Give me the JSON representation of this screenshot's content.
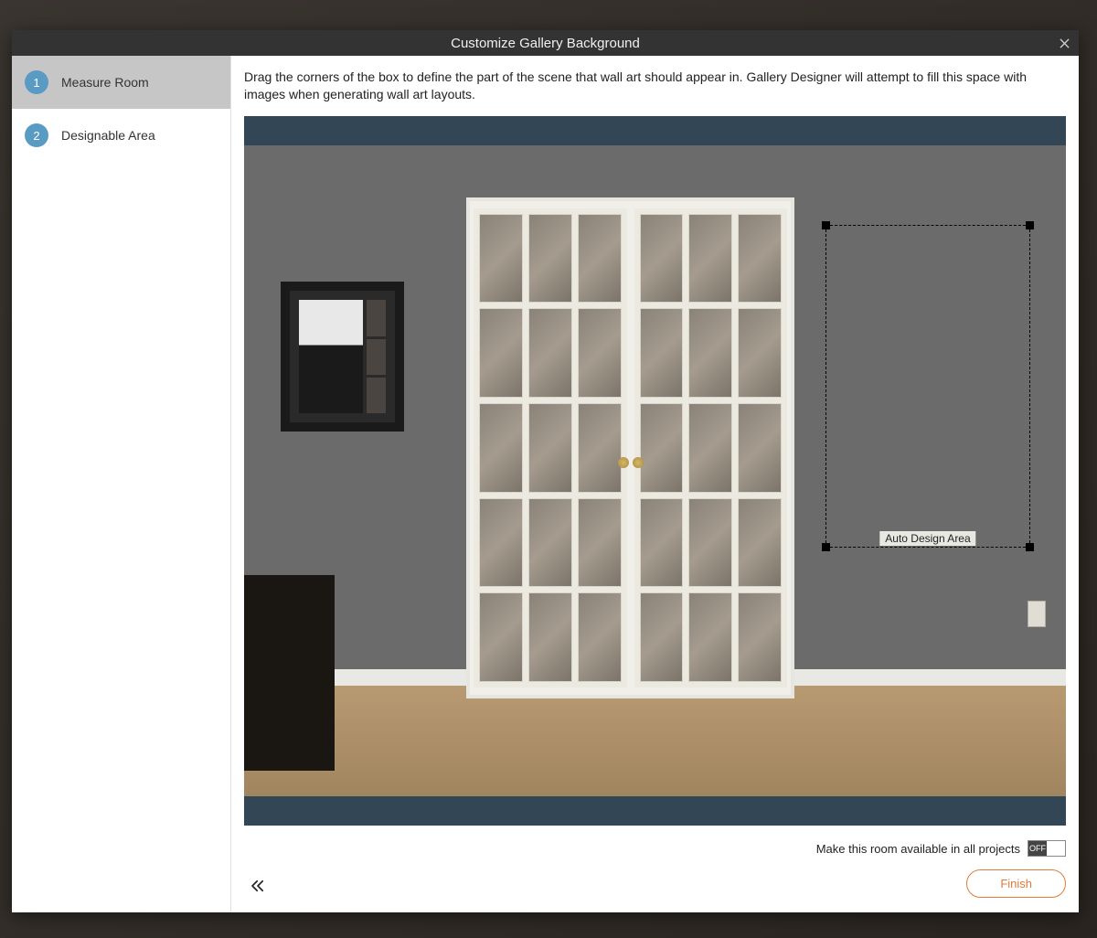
{
  "modal": {
    "title": "Customize Gallery Background"
  },
  "sidebar": {
    "steps": [
      {
        "num": "1",
        "label": "Measure Room",
        "active": true
      },
      {
        "num": "2",
        "label": "Designable Area",
        "active": false
      }
    ]
  },
  "content": {
    "instructions": "Drag the corners of the box to define the part of the scene that wall art should appear in. Gallery Designer will attempt to fill this space with images when generating wall art layouts.",
    "design_area_label": "Auto Design Area"
  },
  "footer": {
    "share_label": "Make this room available in all projects",
    "toggle_state": "OFF",
    "finish_label": "Finish"
  }
}
